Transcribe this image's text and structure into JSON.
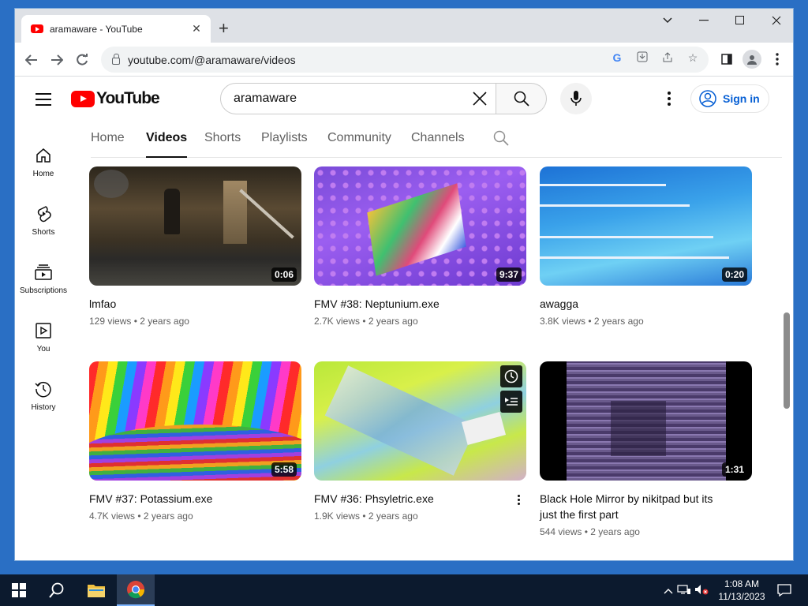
{
  "browser": {
    "tab_title": "aramaware - YouTube",
    "url": "youtube.com/@aramaware/videos"
  },
  "youtube": {
    "logo_text": "YouTube",
    "search_query": "aramaware",
    "sign_in": "Sign in",
    "sidebar": [
      {
        "label": "Home",
        "icon": "home-icon"
      },
      {
        "label": "Shorts",
        "icon": "shorts-icon"
      },
      {
        "label": "Subscriptions",
        "icon": "subscriptions-icon"
      },
      {
        "label": "You",
        "icon": "you-icon"
      },
      {
        "label": "History",
        "icon": "history-icon"
      }
    ],
    "channel_tabs": [
      "Home",
      "Videos",
      "Shorts",
      "Playlists",
      "Community",
      "Channels"
    ],
    "active_tab": "Videos",
    "videos": [
      {
        "title": "lmfao",
        "views": "129 views",
        "age": "2 years ago",
        "duration": "0:06"
      },
      {
        "title": "FMV #38: Neptunium.exe",
        "views": "2.7K views",
        "age": "2 years ago",
        "duration": "9:37"
      },
      {
        "title": "awagga",
        "views": "3.8K views",
        "age": "2 years ago",
        "duration": "0:20"
      },
      {
        "title": "FMV #37: Potassium.exe",
        "views": "4.7K views",
        "age": "2 years ago",
        "duration": "5:58"
      },
      {
        "title": "FMV #36: Phsyletric.exe",
        "views": "1.9K views",
        "age": "2 years ago",
        "duration": ""
      },
      {
        "title": "Black Hole Mirror by nikitpad but its just the first part",
        "views": "544 views",
        "age": "2 years ago",
        "duration": "1:31"
      }
    ]
  },
  "taskbar": {
    "time": "1:08 AM",
    "date": "11/13/2023"
  }
}
